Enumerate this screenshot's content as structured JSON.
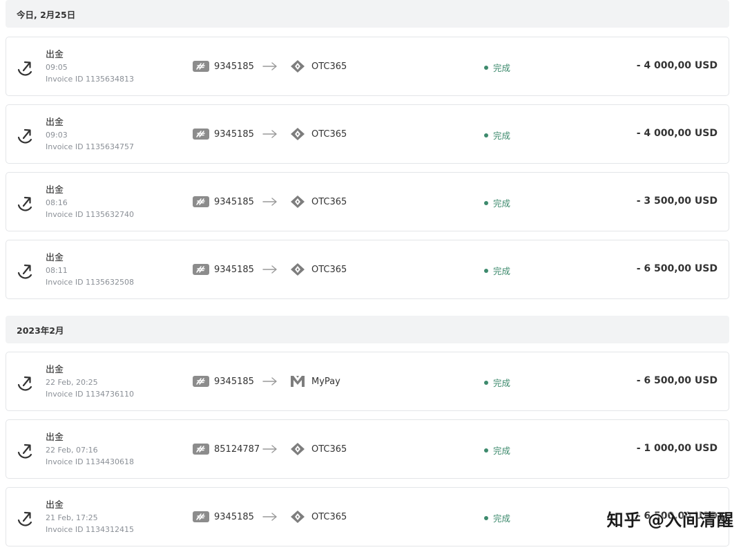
{
  "sections": [
    {
      "header": "今日, 2月25日",
      "rows": [
        {
          "type": "出金",
          "time": "09:05",
          "invoice": "Invoice ID 1135634813",
          "from": "9345185",
          "dest": "OTC365",
          "dest_logo": "otc365-icon",
          "status": "完成",
          "amount": "- 4 000,00 USD"
        },
        {
          "type": "出金",
          "time": "09:03",
          "invoice": "Invoice ID 1135634757",
          "from": "9345185",
          "dest": "OTC365",
          "dest_logo": "otc365-icon",
          "status": "完成",
          "amount": "- 4 000,00 USD"
        },
        {
          "type": "出金",
          "time": "08:16",
          "invoice": "Invoice ID 1135632740",
          "from": "9345185",
          "dest": "OTC365",
          "dest_logo": "otc365-icon",
          "status": "完成",
          "amount": "- 3 500,00 USD"
        },
        {
          "type": "出金",
          "time": "08:11",
          "invoice": "Invoice ID 1135632508",
          "from": "9345185",
          "dest": "OTC365",
          "dest_logo": "otc365-icon",
          "status": "完成",
          "amount": "- 6 500,00 USD"
        }
      ]
    },
    {
      "header": "2023年2月",
      "rows": [
        {
          "type": "出金",
          "time": "22 Feb, 20:25",
          "invoice": "Invoice ID 1134736110",
          "from": "9345185",
          "dest": "MyPay",
          "dest_logo": "mypay-icon",
          "status": "完成",
          "amount": "- 6 500,00 USD"
        },
        {
          "type": "出金",
          "time": "22 Feb, 07:16",
          "invoice": "Invoice ID 1134430618",
          "from": "85124787",
          "dest": "OTC365",
          "dest_logo": "otc365-icon",
          "status": "完成",
          "amount": "- 1 000,00 USD"
        },
        {
          "type": "出金",
          "time": "21 Feb, 17:25",
          "invoice": "Invoice ID 1134312415",
          "from": "9345185",
          "dest": "OTC365",
          "dest_logo": "otc365-icon",
          "status": "完成",
          "amount": "- 6 500,00 USD"
        }
      ]
    }
  ],
  "watermark": "知乎 @入间清醒",
  "colors": {
    "status_green": "#3d8a6d",
    "badge_gray": "#8c8c8c",
    "header_bg": "#f2f3f4",
    "border": "#e3e5e8"
  }
}
